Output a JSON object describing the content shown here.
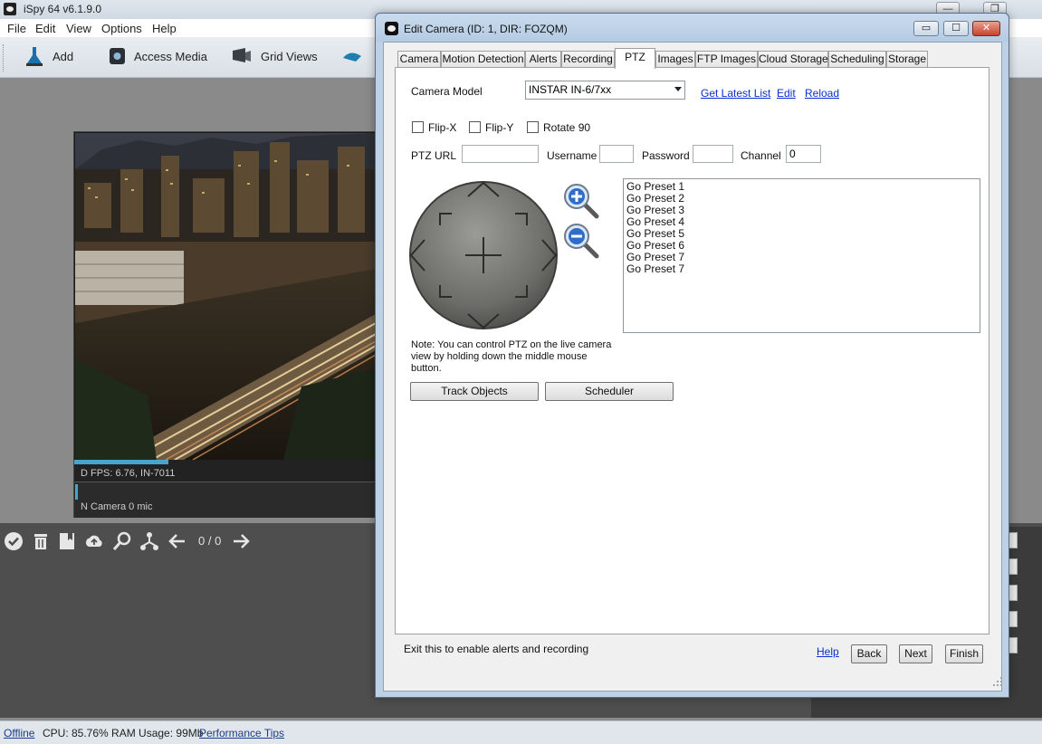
{
  "app": {
    "title": "iSpy 64 v6.1.9.0",
    "window_controls": [
      "—",
      "❐"
    ],
    "menu": [
      "File",
      "Edit",
      "View",
      "Options",
      "Help"
    ],
    "toolbar": [
      "Add",
      "Access Media",
      "Grid Views"
    ]
  },
  "camera_tile": {
    "status_line": "D  FPS: 6.76, IN-7011",
    "status_line2": "N  Camera 0 mic"
  },
  "media_bar": {
    "counter": "0 / 0",
    "icons": [
      "check-icon",
      "trash-icon",
      "bookmark-icon",
      "cloud-upload-icon",
      "search-icon",
      "share-icon",
      "arrow-left-icon",
      "arrow-right-icon"
    ]
  },
  "statusbar": {
    "offline": "Offline",
    "stats": "CPU: 85.76% RAM Usage: 99Mb",
    "perf_tips": "Performance Tips"
  },
  "dialog": {
    "title": "Edit Camera (ID: 1, DIR: FOZQM)",
    "controls": [
      "▭",
      "☐",
      "✕"
    ],
    "tabs": [
      "Camera",
      "Motion Detection",
      "Alerts",
      "Recording",
      "PTZ",
      "Images",
      "FTP Images",
      "Cloud Storage",
      "Scheduling",
      "Storage"
    ],
    "active_tab": "PTZ",
    "ptz": {
      "camera_model_label": "Camera Model",
      "camera_model_value": "INSTAR IN-6/7xx",
      "get_latest_list": "Get Latest List",
      "edit": "Edit",
      "reload": "Reload",
      "flip_x": "Flip-X",
      "flip_y": "Flip-Y",
      "rotate_90": "Rotate 90",
      "ptz_url_label": "PTZ URL",
      "ptz_url_value": "",
      "username_label": "Username",
      "username_value": "",
      "password_label": "Password",
      "password_value": "",
      "channel_label": "Channel",
      "channel_value": "0",
      "presets": [
        "Go Preset 1",
        "Go Preset 2",
        "Go Preset 3",
        "Go Preset 4",
        "Go Preset 5",
        "Go Preset 6",
        "Go Preset 7",
        "Go Preset 7"
      ],
      "note": "Note: You can control PTZ on the live camera view by holding down the middle mouse button.",
      "track_objects": "Track Objects",
      "scheduler": "Scheduler"
    },
    "footer": {
      "hint": "Exit this to enable alerts and recording",
      "help": "Help",
      "back": "Back",
      "next": "Next",
      "finish": "Finish"
    }
  }
}
